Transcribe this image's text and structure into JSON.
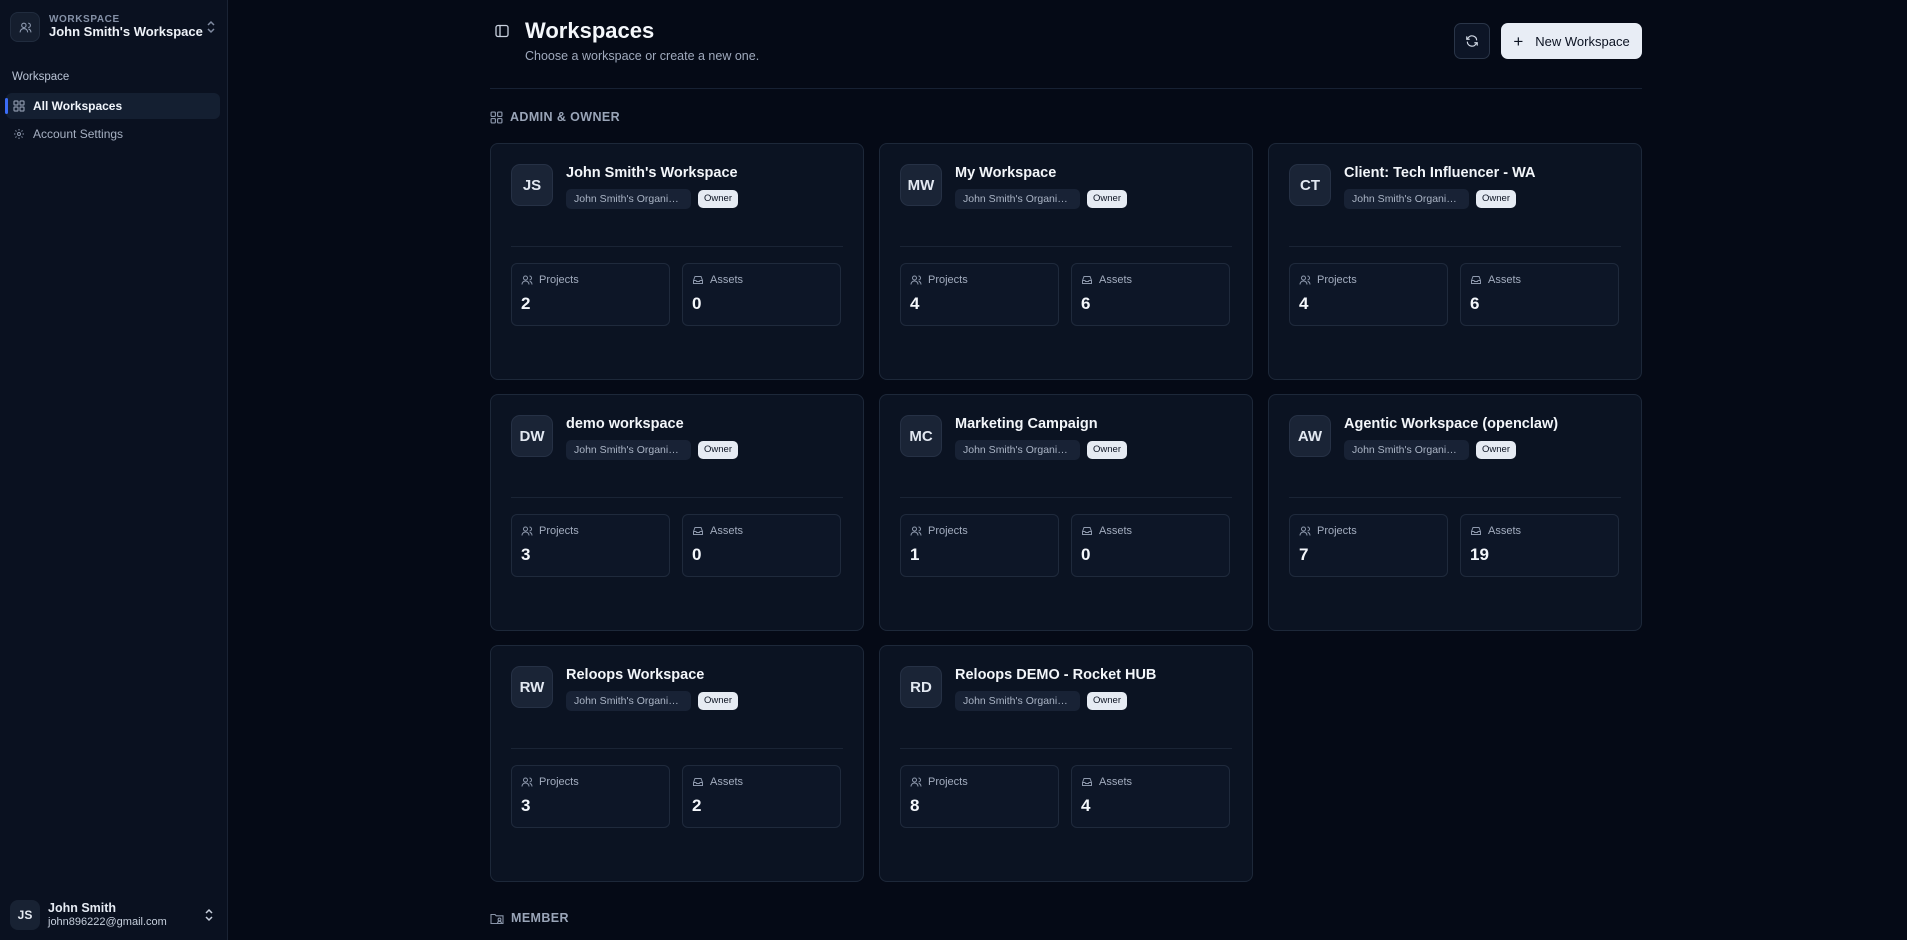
{
  "sidebar": {
    "workspace_kicker": "WORKSPACE",
    "workspace_name": "John Smith's Workspace",
    "section_label": "Workspace",
    "items": [
      {
        "label": "All Workspaces",
        "icon": "grid-icon",
        "active": true
      },
      {
        "label": "Account Settings",
        "icon": "gear-icon",
        "active": false
      }
    ],
    "user": {
      "initials": "JS",
      "name": "John Smith",
      "email": "john896222@gmail.com"
    }
  },
  "header": {
    "title": "Workspaces",
    "subtitle": "Choose a workspace or create a new one.",
    "new_button_label": "New Workspace",
    "refresh_icon": "refresh-icon"
  },
  "groups": {
    "admin_owner_label": "ADMIN & OWNER",
    "member_label": "MEMBER"
  },
  "stat_labels": {
    "projects": "Projects",
    "assets": "Assets"
  },
  "workspaces": [
    {
      "initials": "JS",
      "name": "John Smith's Workspace",
      "org": "John Smith's Organization",
      "role": "Owner",
      "projects": "2",
      "assets": "0"
    },
    {
      "initials": "MW",
      "name": "My Workspace",
      "org": "John Smith's Organization",
      "role": "Owner",
      "projects": "4",
      "assets": "6"
    },
    {
      "initials": "CT",
      "name": "Client: Tech Influencer - WA",
      "org": "John Smith's Organization",
      "role": "Owner",
      "projects": "4",
      "assets": "6"
    },
    {
      "initials": "DW",
      "name": "demo workspace",
      "org": "John Smith's Organization",
      "role": "Owner",
      "projects": "3",
      "assets": "0"
    },
    {
      "initials": "MC",
      "name": "Marketing Campaign",
      "org": "John Smith's Organization",
      "role": "Owner",
      "projects": "1",
      "assets": "0"
    },
    {
      "initials": "AW",
      "name": "Agentic Workspace (openclaw)",
      "org": "John Smith's Organization",
      "role": "Owner",
      "projects": "7",
      "assets": "19"
    },
    {
      "initials": "RW",
      "name": "Reloops Workspace",
      "org": "John Smith's Organization",
      "role": "Owner",
      "projects": "3",
      "assets": "2"
    },
    {
      "initials": "RD",
      "name": "Reloops DEMO - Rocket HUB",
      "org": "John Smith's Organization",
      "role": "Owner",
      "projects": "8",
      "assets": "4"
    }
  ],
  "colors": {
    "background": "#050a16",
    "sidebar": "#0a1120",
    "card": "#0b1322",
    "accent": "#3b6cf6",
    "primary_button": "#e8edf5"
  }
}
